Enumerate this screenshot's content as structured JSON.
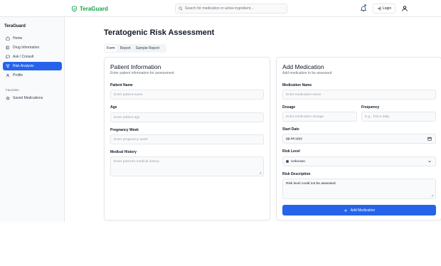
{
  "header": {
    "brand": "TeraGuard",
    "search_placeholder": "Search for medication or active ingredient...",
    "login_label": "Login"
  },
  "sidebar": {
    "title": "TeraGuard",
    "items": [
      {
        "label": "Home",
        "icon": "home-icon"
      },
      {
        "label": "Drug Information",
        "icon": "book-icon"
      },
      {
        "label": "Ask / Consult",
        "icon": "chat-icon"
      },
      {
        "label": "Risk Analysis",
        "icon": "filter-icon",
        "active": true
      },
      {
        "label": "Profile",
        "icon": "user-icon"
      }
    ],
    "favorites_title": "Favorites",
    "favorites": [
      {
        "label": "Saved Medications",
        "icon": "star-icon"
      }
    ]
  },
  "main": {
    "title": "Teratogenic Risk Assessment",
    "tabs": [
      {
        "label": "Form",
        "active": true
      },
      {
        "label": "Report"
      },
      {
        "label": "Sample Report"
      }
    ]
  },
  "patient": {
    "title": "Patient Information",
    "subtitle": "Enter patient information for assessment",
    "name_label": "Patient Name",
    "name_placeholder": "Enter patient name",
    "age_label": "Age",
    "age_placeholder": "Enter patient age",
    "week_label": "Pregnancy Week",
    "week_placeholder": "Enter pregnancy week",
    "history_label": "Medical History",
    "history_placeholder": "Enter patient's medical history"
  },
  "medication": {
    "title": "Add Medication",
    "subtitle": "Add medication to be assessed",
    "name_label": "Medication Name",
    "name_placeholder": "Enter medication name",
    "dosage_label": "Dosage",
    "dosage_placeholder": "Enter medication dosage",
    "frequency_label": "Frequency",
    "frequency_placeholder": "E.g., Twice daily",
    "start_label": "Start Date",
    "start_value": "gg.aa.yyyy",
    "risk_label": "Risk Level",
    "risk_value": "Unknown",
    "desc_label": "Risk Description",
    "desc_value": "Risk level could not be assessed.",
    "add_button": "Add Medication"
  },
  "colors": {
    "brand": "#16a34a",
    "accent": "#2563eb"
  }
}
